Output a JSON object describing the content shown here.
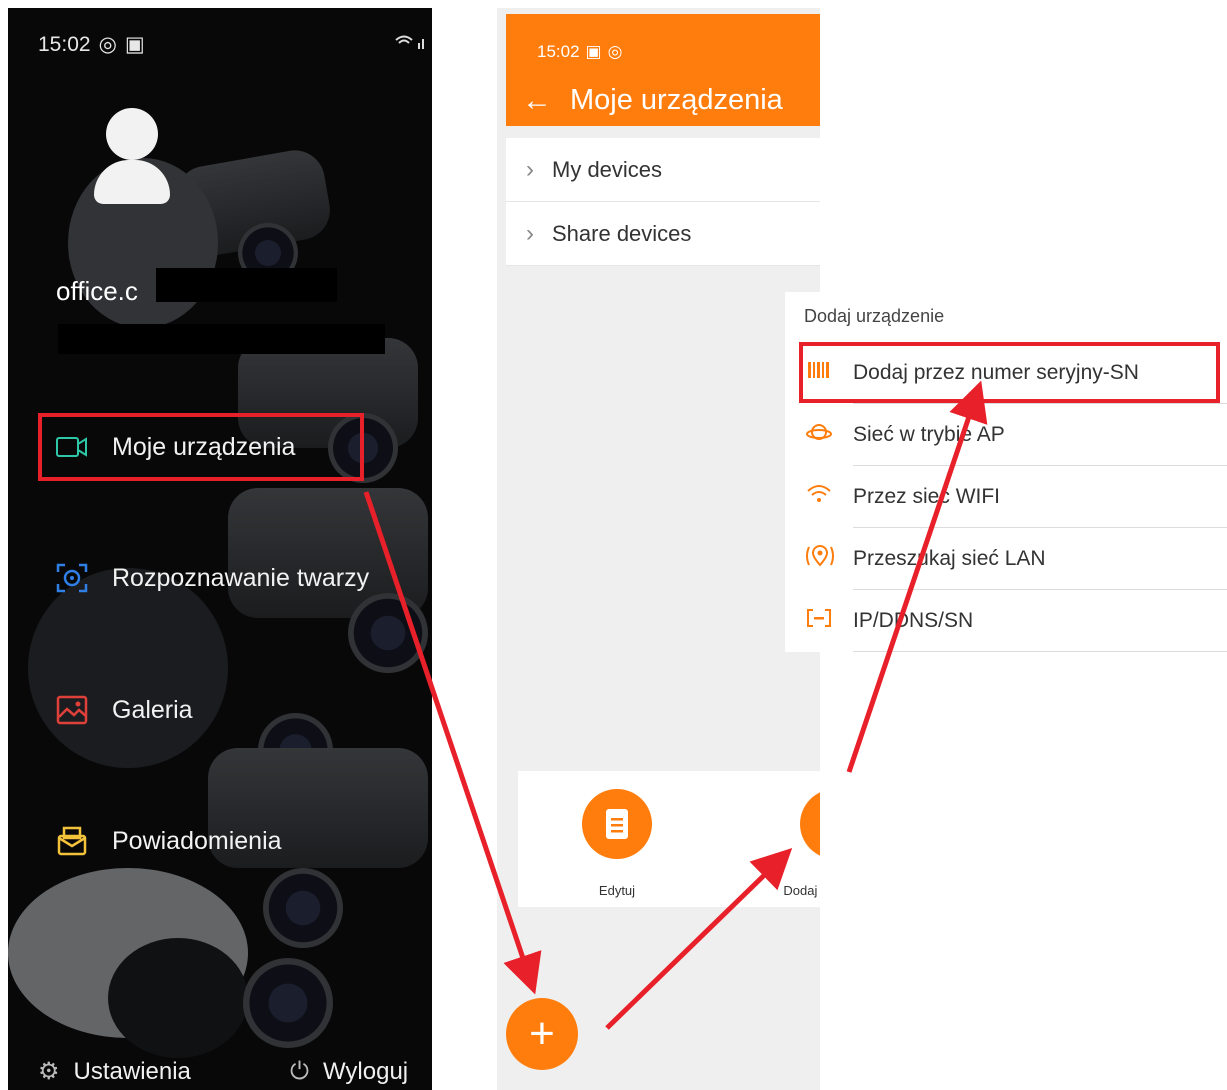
{
  "left": {
    "status_time": "15:02",
    "user_name": "office.c",
    "menu": [
      {
        "label": "Moje urządzenia",
        "icon": "camera-icon"
      },
      {
        "label": "Rozpoznawanie twarzy",
        "icon": "face-scan-icon"
      },
      {
        "label": "Galeria",
        "icon": "gallery-icon"
      },
      {
        "label": "Powiadomienia",
        "icon": "mail-icon"
      }
    ],
    "settings_label": "Ustawienia",
    "logout_label": "Wyloguj"
  },
  "right": {
    "status_time": "15:02",
    "title": "Moje urządzenia",
    "list": [
      {
        "label": "My devices"
      },
      {
        "label": "Share devices"
      }
    ],
    "actions": [
      {
        "label": "Edytuj",
        "icon": "document-icon"
      },
      {
        "label": "Dodaj urządzenie",
        "icon": "add-camera-icon"
      }
    ],
    "fab_icon": "plus-icon"
  },
  "popup": {
    "title": "Dodaj urządzenie",
    "items": [
      {
        "label": "Dodaj przez numer seryjny-SN",
        "icon": "barcode-icon"
      },
      {
        "label": "Sieć w trybie AP",
        "icon": "planet-icon"
      },
      {
        "label": "Przez sieć WIFI",
        "icon": "wifi-icon"
      },
      {
        "label": "Przeszukaj sieć LAN",
        "icon": "location-scan-icon"
      },
      {
        "label": "IP/DDNS/SN",
        "icon": "ip-icon"
      }
    ]
  },
  "colors": {
    "accent": "#ff7d0d",
    "highlight": "#e8202a",
    "drawer_bg": "#0d0d0f"
  }
}
